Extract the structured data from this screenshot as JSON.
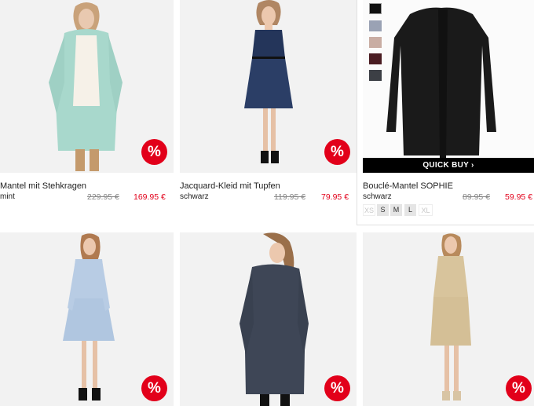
{
  "products": [
    {
      "name": "Mantel mit Stehkragen",
      "color": "mint",
      "old_price": "229.95 €",
      "new_price": "169.95 €",
      "sale_badge": "%"
    },
    {
      "name": "Jacquard-Kleid mit Tupfen",
      "color": "schwarz",
      "old_price": "119.95 €",
      "new_price": "79.95 €",
      "sale_badge": "%"
    },
    {
      "name": "Bouclé-Mantel SOPHIE",
      "color": "schwarz",
      "old_price": "89.95 €",
      "new_price": "59.95 €",
      "quick_buy": "QUICK BUY ›",
      "sizes": [
        {
          "label": "XS",
          "available": false
        },
        {
          "label": "S",
          "available": true
        },
        {
          "label": "M",
          "available": true
        },
        {
          "label": "L",
          "available": true
        },
        {
          "label": "XL",
          "available": false
        }
      ],
      "swatches": [
        "#111111",
        "#9aa2b4",
        "#c9ada3",
        "#4a1c22",
        "#3c3f45"
      ]
    },
    {
      "sale_badge": "%"
    },
    {
      "sale_badge": "%"
    },
    {
      "sale_badge": "%"
    }
  ],
  "colors": {
    "sale": "#e2001a",
    "quick_buy_bg": "#000000"
  }
}
